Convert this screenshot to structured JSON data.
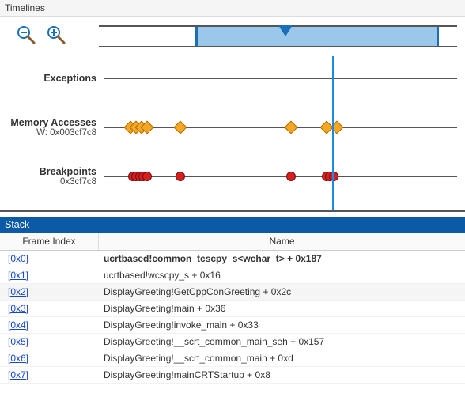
{
  "timelines": {
    "title": "Timelines",
    "zoom_out_icon": "zoom-out",
    "zoom_in_icon": "zoom-in",
    "overview": {
      "sel_start_pct": 27,
      "sel_end_pct": 95,
      "marker_pct": 37
    },
    "playhead_pct": 64.5,
    "tracks": [
      {
        "title": "Exceptions",
        "sub": "",
        "marker_type": "none",
        "positions": []
      },
      {
        "title": "Memory Accesses",
        "sub": "W: 0x003cf7c8",
        "marker_type": "diamond",
        "positions": [
          7.5,
          9,
          10.5,
          12,
          21.5,
          53,
          63,
          66
        ]
      },
      {
        "title": "Breakpoints",
        "sub": "0x3cf7c8",
        "marker_type": "circle",
        "positions": [
          8,
          9,
          10,
          11,
          12,
          21.5,
          53,
          63,
          64,
          65
        ]
      }
    ]
  },
  "stack": {
    "title": "Stack",
    "col_idx": "Frame Index",
    "col_name": "Name",
    "frames": [
      {
        "idx": "[0x0]",
        "name": "ucrtbased!common_tcscpy_s<wchar_t> + 0x187",
        "bold": true
      },
      {
        "idx": "[0x1]",
        "name": "ucrtbased!wcscpy_s + 0x16"
      },
      {
        "idx": "[0x2]",
        "name": "DisplayGreeting!GetCppConGreeting + 0x2c",
        "sel": true
      },
      {
        "idx": "[0x3]",
        "name": "DisplayGreeting!main + 0x36"
      },
      {
        "idx": "[0x4]",
        "name": "DisplayGreeting!invoke_main + 0x33"
      },
      {
        "idx": "[0x5]",
        "name": "DisplayGreeting!__scrt_common_main_seh + 0x157"
      },
      {
        "idx": "[0x6]",
        "name": "DisplayGreeting!__scrt_common_main + 0xd"
      },
      {
        "idx": "[0x7]",
        "name": "DisplayGreeting!mainCRTStartup + 0x8"
      }
    ]
  }
}
